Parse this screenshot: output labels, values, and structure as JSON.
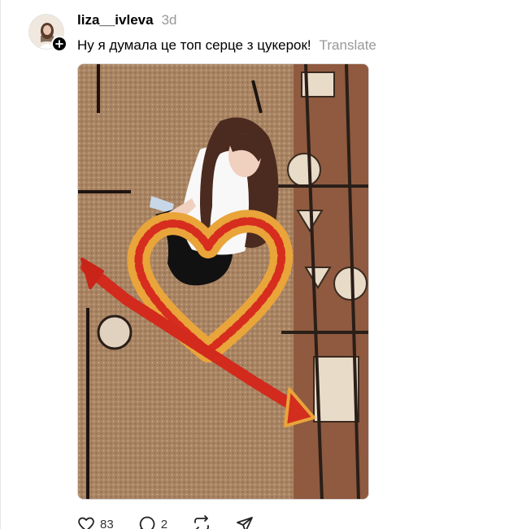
{
  "post": {
    "author": {
      "username": "liza__ivleva",
      "avatar_icon": "profile-photo",
      "follow_icon": "plus-icon"
    },
    "timestamp": "3d",
    "caption": "Ну я думала це топ серце з цукерок!",
    "translate_label": "Translate",
    "image": {
      "description_icon": "photo-girl-heart-candies"
    },
    "actions": {
      "like": {
        "icon": "heart-icon",
        "count": "83"
      },
      "comment": {
        "icon": "comment-icon",
        "count": "2"
      },
      "repost": {
        "icon": "repost-icon"
      },
      "share": {
        "icon": "send-icon"
      }
    }
  },
  "colors": {
    "text_primary": "#000000",
    "text_secondary": "#999999",
    "border": "#e6e6e6"
  }
}
